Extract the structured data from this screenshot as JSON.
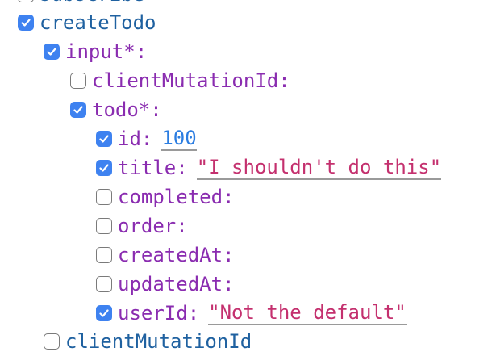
{
  "fields": {
    "partial_top": {
      "name": "subscribe",
      "checked": false
    },
    "createTodo": {
      "name": "createTodo",
      "checked": true
    },
    "input": {
      "name": "input*:",
      "checked": true
    },
    "input_clientMutationId": {
      "name": "clientMutationId:",
      "checked": false
    },
    "todo": {
      "name": "todo*:",
      "checked": true
    },
    "id": {
      "name": "id:",
      "checked": true,
      "value": "100"
    },
    "title": {
      "name": "title:",
      "checked": true,
      "value": "\"I shouldn't do this\""
    },
    "completed": {
      "name": "completed:",
      "checked": false
    },
    "order": {
      "name": "order:",
      "checked": false
    },
    "createdAt": {
      "name": "createdAt:",
      "checked": false
    },
    "updatedAt": {
      "name": "updatedAt:",
      "checked": false
    },
    "userId": {
      "name": "userId:",
      "checked": true,
      "value": "\"Not the default\""
    },
    "clientMutationId_bottom": {
      "name": "clientMutationId",
      "checked": false
    }
  },
  "colors": {
    "checkbox_checked": "#3e82f0",
    "field_name_blue": "#1f61a0",
    "field_name_purple": "#8a2cb0",
    "number_value": "#2b7de1",
    "string_value": "#c4306e"
  }
}
